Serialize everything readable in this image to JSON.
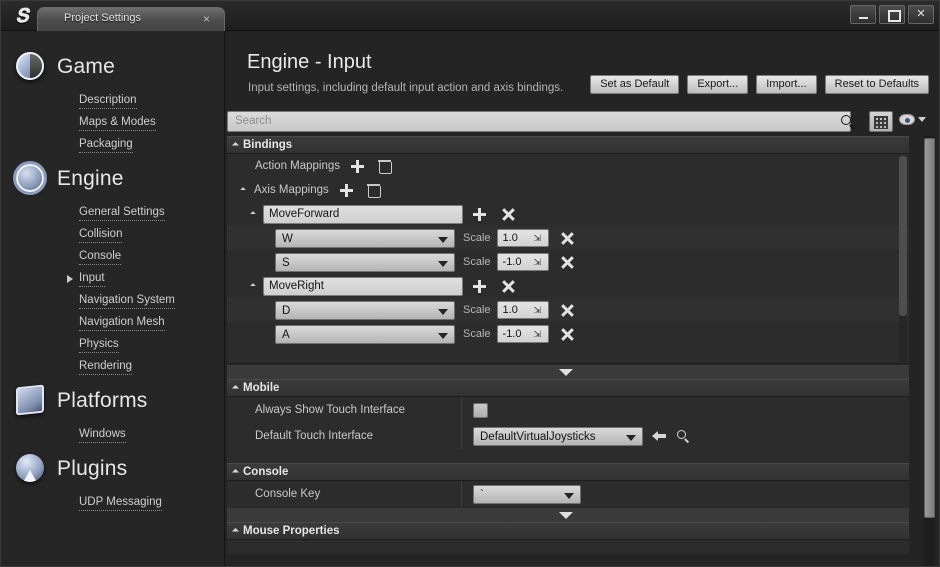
{
  "window": {
    "tab_title": "Project Settings",
    "tab_close": "×",
    "logo": "unreal-logo",
    "controls": {
      "minimize": "minimize-icon",
      "maximize": "maximize-icon",
      "close": "✕"
    }
  },
  "sidebar": {
    "groups": [
      {
        "title": "Game",
        "icon": "stopwatch-icon",
        "items": [
          {
            "label": "Description",
            "expandable": false
          },
          {
            "label": "Maps & Modes",
            "expandable": false
          },
          {
            "label": "Packaging",
            "expandable": false
          }
        ]
      },
      {
        "title": "Engine",
        "icon": "gear-icon",
        "items": [
          {
            "label": "General Settings",
            "expandable": false
          },
          {
            "label": "Collision",
            "expandable": false
          },
          {
            "label": "Console",
            "expandable": false
          },
          {
            "label": "Input",
            "expandable": true
          },
          {
            "label": "Navigation System",
            "expandable": false
          },
          {
            "label": "Navigation Mesh",
            "expandable": false
          },
          {
            "label": "Physics",
            "expandable": false
          },
          {
            "label": "Rendering",
            "expandable": false
          }
        ]
      },
      {
        "title": "Platforms",
        "icon": "monitor-gamepad-icon",
        "items": [
          {
            "label": "Windows",
            "expandable": false
          }
        ]
      },
      {
        "title": "Plugins",
        "icon": "plugin-icon",
        "items": [
          {
            "label": "UDP Messaging",
            "expandable": false
          }
        ]
      }
    ]
  },
  "main": {
    "title": "Engine - Input",
    "description": "Input settings, including default input action and axis bindings.",
    "buttons": {
      "set_as_default": "Set as Default",
      "export": "Export...",
      "import": "Import...",
      "reset_to_defaults": "Reset to Defaults"
    },
    "search": {
      "placeholder": "Search",
      "icon": "search-icon"
    },
    "view_options": {
      "grid_icon": "grid-icon",
      "eye_icon": "eye-icon",
      "caret": "chevron-down-icon"
    }
  },
  "sections": {
    "bindings": {
      "header": "Bindings",
      "action_mappings": {
        "label": "Action Mappings",
        "add": "add-icon",
        "delete": "trash-icon"
      },
      "axis_mappings": {
        "label": "Axis Mappings",
        "add": "add-icon",
        "delete": "trash-icon"
      },
      "axis_groups": [
        {
          "name": "MoveForward",
          "keys": [
            {
              "key": "W",
              "scale_label": "Scale",
              "scale": "1.0"
            },
            {
              "key": "S",
              "scale_label": "Scale",
              "scale": "-1.0"
            }
          ]
        },
        {
          "name": "MoveRight",
          "keys": [
            {
              "key": "D",
              "scale_label": "Scale",
              "scale": "1.0"
            },
            {
              "key": "A",
              "scale_label": "Scale",
              "scale": "-1.0"
            }
          ]
        }
      ]
    },
    "mobile": {
      "header": "Mobile",
      "rows": [
        {
          "label": "Always Show Touch Interface",
          "type": "checkbox",
          "checked": false
        },
        {
          "label": "Default Touch Interface",
          "type": "asset",
          "value": "DefaultVirtualJoysticks"
        }
      ]
    },
    "console": {
      "header": "Console",
      "rows": [
        {
          "label": "Console Key",
          "type": "combo",
          "value": "`"
        }
      ]
    },
    "mouse_properties": {
      "header": "Mouse Properties"
    }
  },
  "colors": {
    "panel_bg": "#242424",
    "sidebar_bg": "#262626",
    "row_bg": "#2c2c2c",
    "header_bg": "#3b3b3b",
    "accent_text": "#e8e8e8"
  }
}
